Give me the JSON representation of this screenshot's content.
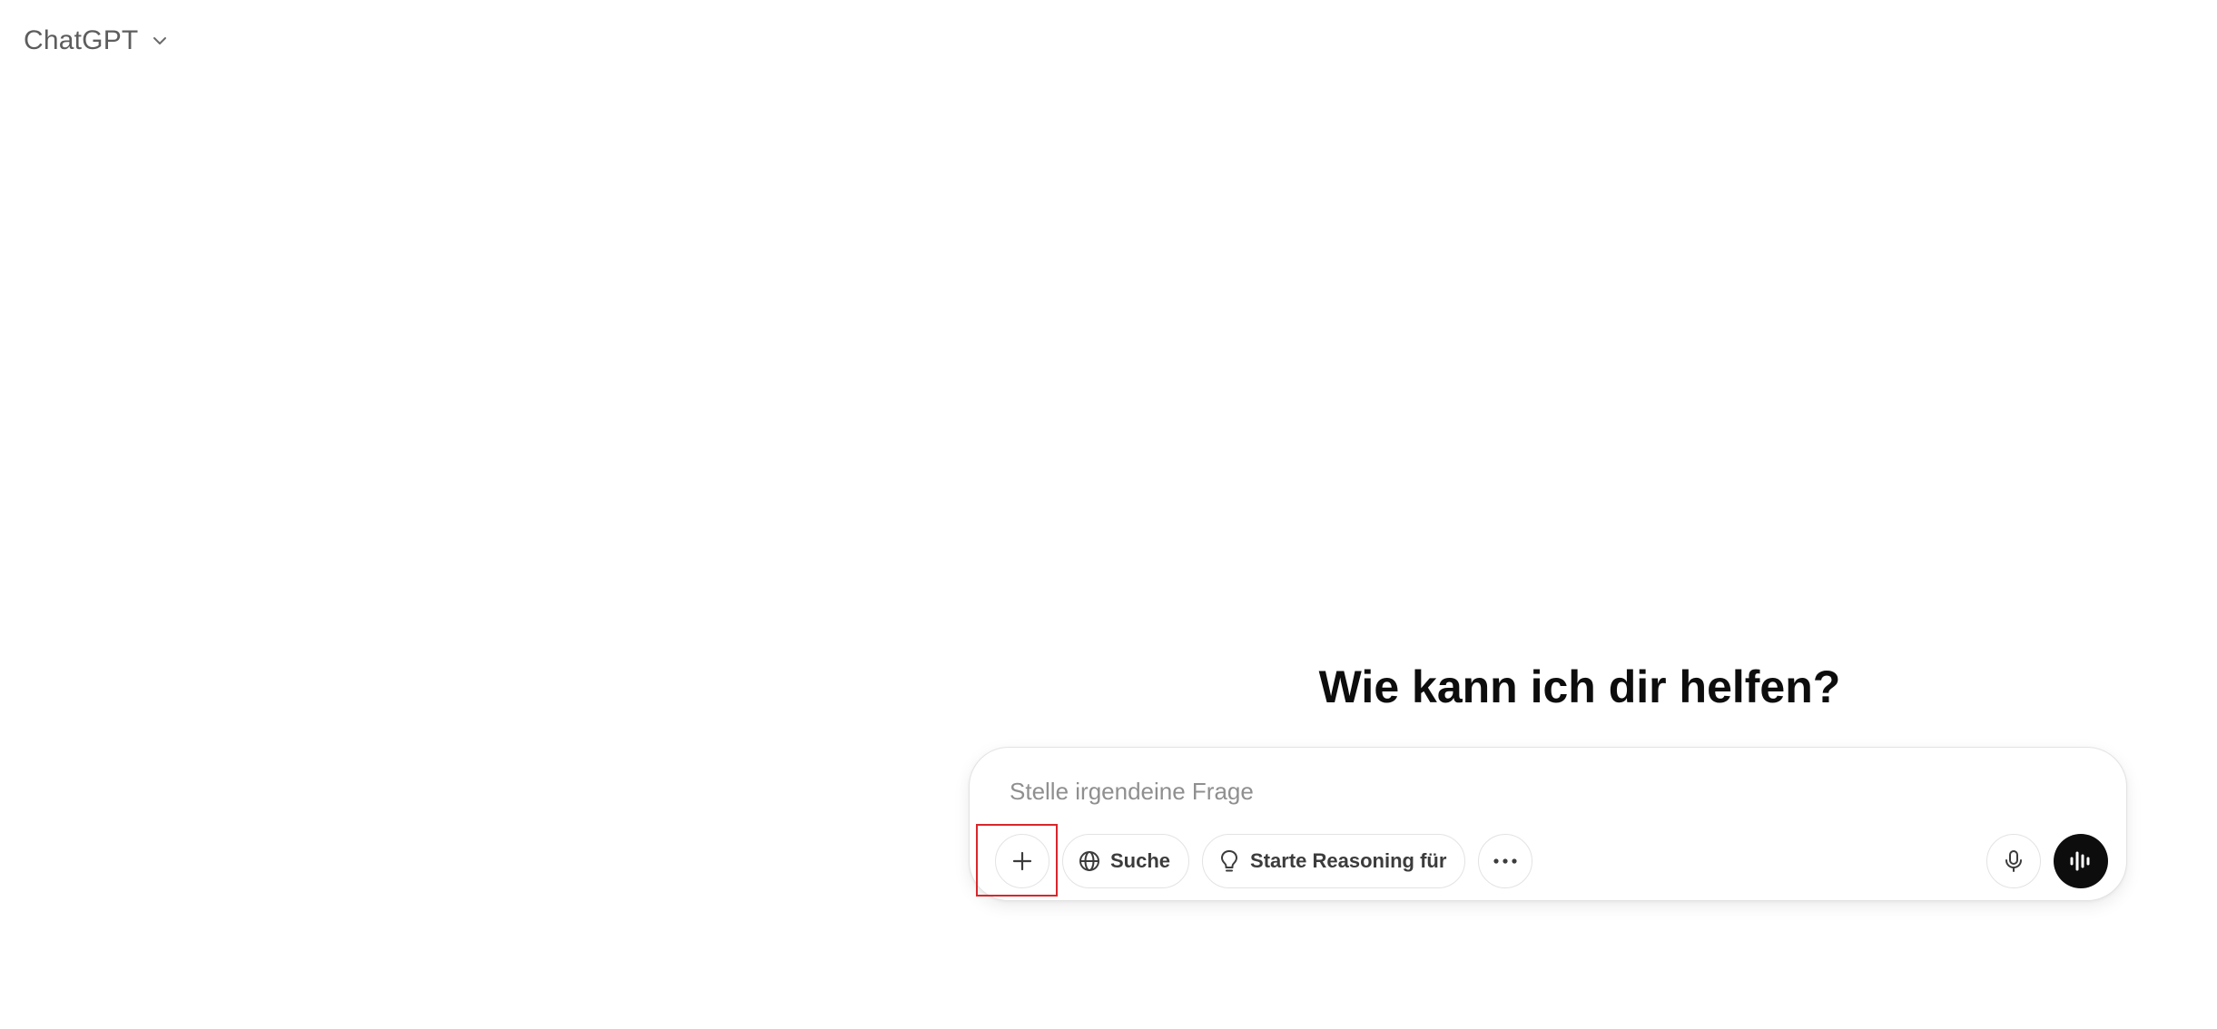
{
  "header": {
    "model_name": "ChatGPT",
    "chevron_icon": "chevron-down-icon"
  },
  "main": {
    "heading": "Wie kann ich dir helfen?"
  },
  "composer": {
    "placeholder": "Stelle irgendeine Frage",
    "value": "",
    "buttons": {
      "attach_icon": "plus-icon",
      "search_label": "Suche",
      "search_icon": "globe-icon",
      "reason_label": "Starte Reasoning für",
      "reason_icon": "lightbulb-icon",
      "more_icon": "ellipsis-icon",
      "dictate_icon": "microphone-icon",
      "voice_icon": "voice-waveform-icon"
    }
  },
  "colors": {
    "accent_dark": "#0d0d0d",
    "border": "#e3e3e3",
    "placeholder": "#8f8f8f",
    "highlight": "#d9262b"
  }
}
